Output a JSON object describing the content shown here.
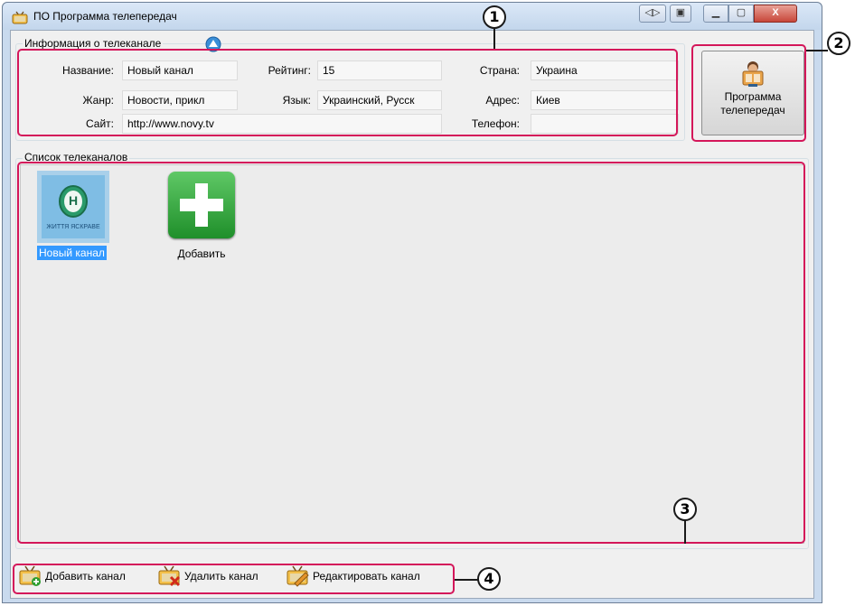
{
  "window": {
    "title": "ПО Программа телепередач",
    "colors": {
      "titlebar": "#c9daee",
      "close_button": "#c8473a",
      "callout": "#d4175a",
      "selection": "#3399ff"
    }
  },
  "info_group": {
    "legend": "Информация о телеканале",
    "name_label": "Название:",
    "name_value": "Новый канал",
    "genre_label": "Жанр:",
    "genre_value": "Новости, прикл",
    "site_label": "Сайт:",
    "site_value": "http://www.novy.tv",
    "rating_label": "Рейтинг:",
    "rating_value": "15",
    "language_label": "Язык:",
    "language_value": "Украинский, Русск",
    "country_label": "Страна:",
    "country_value": "Украина",
    "address_label": "Адрес:",
    "address_value": "Киев",
    "phone_label": "Телефон:",
    "phone_value": ""
  },
  "program_button": {
    "line1": "Программа",
    "line2": "телепередач"
  },
  "channels_group": {
    "legend": "Список телеканалов",
    "items": [
      {
        "label": "Новый канал",
        "logo_text": "ЖИТТЯ ЯСКРАВЕ",
        "logo_letter": "Н",
        "selected": true
      },
      {
        "label": "Добавить",
        "selected": false
      }
    ]
  },
  "toolbar": {
    "add_channel": "Добавить канал",
    "delete_channel": "Удалить канал",
    "edit_channel": "Редактировать канал"
  },
  "callouts": [
    "1",
    "2",
    "3",
    "4"
  ]
}
